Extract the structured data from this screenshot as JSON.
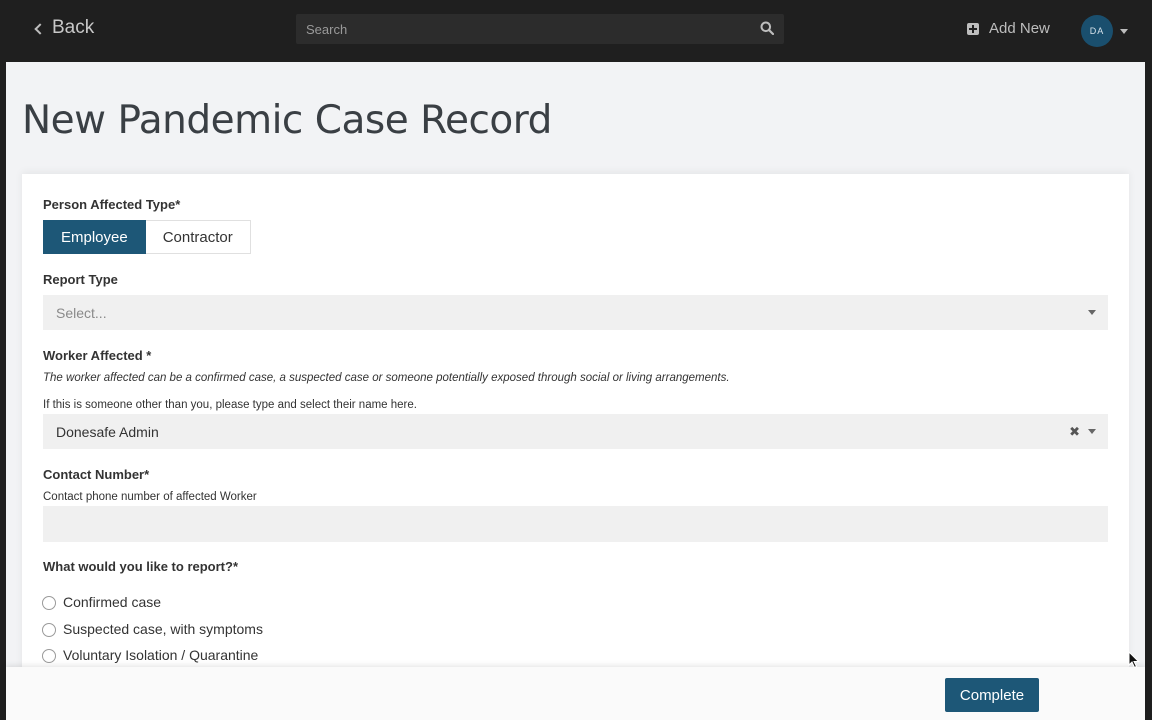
{
  "navbar": {
    "back_label": "Back",
    "search_placeholder": "Search",
    "add_new_label": "Add New",
    "avatar_initials": "DA"
  },
  "page": {
    "title": "New Pandemic Case Record"
  },
  "form": {
    "person_affected_type": {
      "label": "Person Affected Type*",
      "options": [
        "Employee",
        "Contractor"
      ],
      "selected": "Employee"
    },
    "report_type": {
      "label": "Report Type",
      "placeholder": "Select..."
    },
    "worker_affected": {
      "label": "Worker Affected *",
      "help_italic": "The worker affected can be a confirmed case, a suspected case or someone potentially exposed through social or living arrangements.",
      "help": "If this is someone other than you, please type and select their name here.",
      "value": "Donesafe Admin",
      "clear_symbol": "✖"
    },
    "contact_number": {
      "label": "Contact Number*",
      "help": "Contact phone number of affected Worker",
      "value": ""
    },
    "what_to_report": {
      "label": "What would you like to report?*",
      "options": [
        "Confirmed case",
        "Suspected case, with symptoms",
        "Voluntary Isolation / Quarantine"
      ]
    }
  },
  "footer": {
    "complete_label": "Complete"
  },
  "colors": {
    "navbar_bg": "#1f1f1f",
    "accent": "#1d5777",
    "page_bg": "#f2f3f5",
    "field_bg": "#f0f0f0"
  }
}
